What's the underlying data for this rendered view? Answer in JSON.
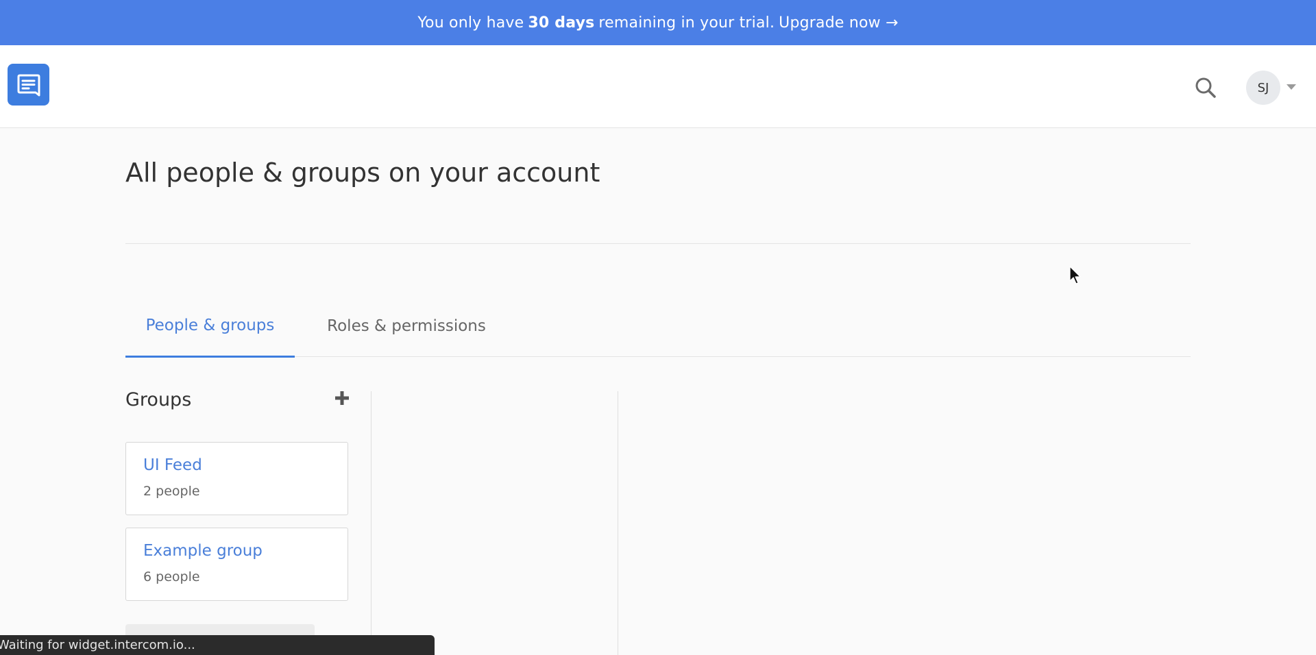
{
  "banner": {
    "prefix": "You only have",
    "highlight": "30 days",
    "suffix": "remaining in your trial.",
    "cta": "Upgrade now →"
  },
  "header": {
    "logo_icon": "chat-bubble-icon",
    "search_icon": "search-icon",
    "avatar_initials": "SJ",
    "avatar_menu_icon": "caret-down-icon"
  },
  "page": {
    "title": "All people & groups on your account"
  },
  "tabs": [
    {
      "label": "People & groups",
      "active": true
    },
    {
      "label": "Roles & permissions",
      "active": false
    }
  ],
  "groups": {
    "heading": "Groups",
    "add_icon": "plus-icon",
    "items": [
      {
        "name": "UI Feed",
        "count": "2 people"
      },
      {
        "name": "Example group",
        "count": "6 people"
      }
    ]
  },
  "status": {
    "text": "Waiting for widget.intercom.io..."
  },
  "colors": {
    "banner": "#4b7fe6",
    "accent": "#3d7ddf",
    "link": "#4a7fd9"
  }
}
